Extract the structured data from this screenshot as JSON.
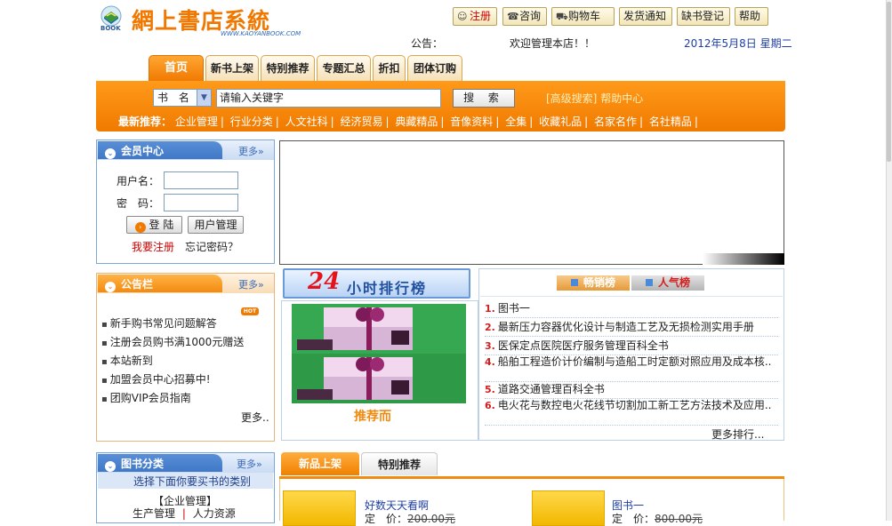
{
  "header": {
    "brand_badge": "BOOK",
    "title": "網上書店系統",
    "url": "WWW.KAOYANBOOK.COM",
    "notice_label": "公告：",
    "notice_text": "欢迎管理本店！！",
    "date": "2012年5月8日  星期二"
  },
  "topnav": {
    "register": "注册",
    "consult": "咨询",
    "cart": "购物车",
    "shipping": "发货通知",
    "missing": "缺书登记",
    "help": "帮助"
  },
  "tabs": [
    "首页",
    "新书上架",
    "特别推荐",
    "专题汇总",
    "折扣",
    "团体订购"
  ],
  "search": {
    "field_select": "书 名",
    "keyword_placeholder": "请输入关键字",
    "button": "搜 索",
    "advanced": "[高级搜索]",
    "help_center": "帮助中心"
  },
  "recommend": {
    "label": "最新推荐：",
    "items": [
      "企业管理",
      "行业分类",
      "人文社科",
      "经济贸易",
      "典藏精品",
      "音像资料",
      "全集",
      "收藏礼品",
      "名家名作",
      "名社精品"
    ]
  },
  "member": {
    "title": "会员中心",
    "more": "更多»",
    "username_label": "用户名：",
    "password_label": "密　码：",
    "login": "登 陆",
    "user_manage": "用户管理",
    "register": "我要注册",
    "forgot": "忘记密码？"
  },
  "bulletin": {
    "title": "公告栏",
    "more": "更多»",
    "hot": "HOT",
    "items": [
      "新手购书常见问题解答",
      "注册会员购书满1000元赠送",
      "本站新到",
      "加盟会员中心招募中!",
      "团购VIP会员指南"
    ],
    "more_bottom": "更多.."
  },
  "category": {
    "title": "图书分类",
    "more": "更多»",
    "hint": "选择下面你要买书的类别",
    "group": "【企业管理】",
    "sub1": "生产管理",
    "sub2": "人力资源"
  },
  "ranking": {
    "num": "24",
    "title": "小时排行榜",
    "tab_best": "畅销榜",
    "tab_popular": "人气榜",
    "gift_caption": "推荐而",
    "items": [
      {
        "n": "1.",
        "t": "图书一"
      },
      {
        "n": "2.",
        "t": "最新压力容器优化设计与制造工艺及无损检测实用手册"
      },
      {
        "n": "3.",
        "t": "医保定点医院医疗服务管理百科全书"
      },
      {
        "n": "4.",
        "t": "船舶工程造价计价编制与造船工时定额对照应用及成本核.."
      },
      {
        "n": "5.",
        "t": "道路交通管理百科全书"
      },
      {
        "n": "6.",
        "t": "电火花与数控电火花线节切割加工新工艺方法技术及应用.."
      }
    ],
    "more": "更多排行..."
  },
  "newbooks": {
    "tab_new": "新品上架",
    "tab_special": "特别推荐",
    "books": [
      {
        "title": "好数天天看啊",
        "price_label": "定　价：",
        "price": "200.00元"
      },
      {
        "title": "图书一",
        "price_label": "定　价：",
        "price": "800.00元"
      }
    ]
  }
}
